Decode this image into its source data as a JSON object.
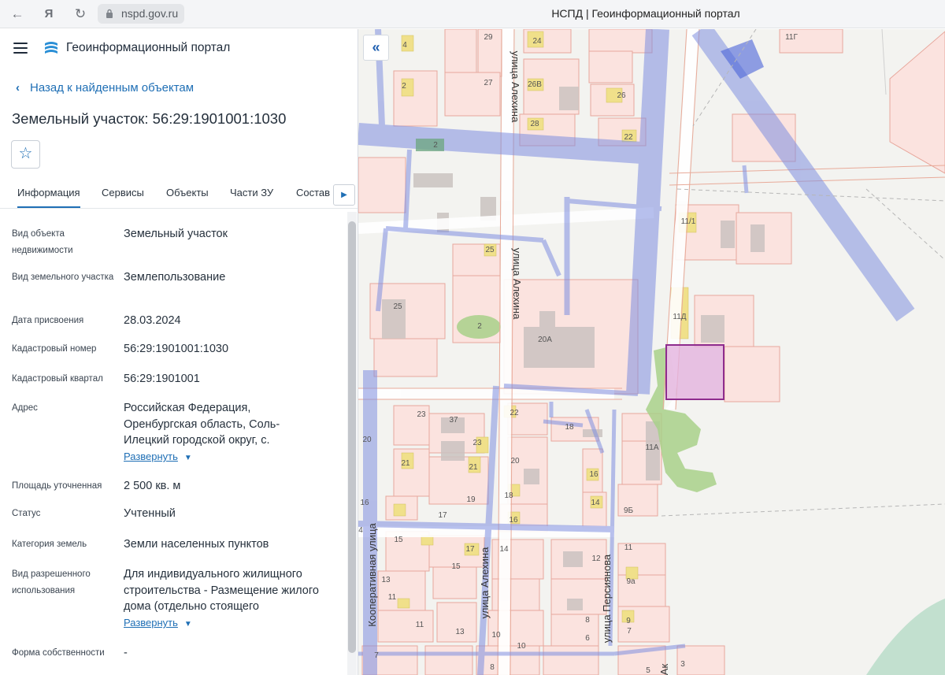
{
  "browser": {
    "url": "nspd.gov.ru",
    "tab_title": "НСПД | Геоинформационный портал"
  },
  "header": {
    "title": "Геоинформационный портал"
  },
  "back_link": "Назад к найденным объектам",
  "object_title": "Земельный участок: 56:29:1901001:1030",
  "tabs": [
    {
      "label": "Информация",
      "active": true
    },
    {
      "label": "Сервисы"
    },
    {
      "label": "Объекты"
    },
    {
      "label": "Части ЗУ"
    },
    {
      "label": "Состав"
    }
  ],
  "details": {
    "object_type": {
      "label": "Вид объекта недвижимости",
      "value": "Земельный участок"
    },
    "land_type": {
      "label": "Вид земельного участка",
      "value": "Землепользование"
    },
    "assign_date": {
      "label": "Дата присвоения",
      "value": "28.03.2024"
    },
    "cad_number": {
      "label": "Кадастровый номер",
      "value": "56:29:1901001:1030"
    },
    "cad_quarter": {
      "label": "Кадастровый квартал",
      "value": "56:29:1901001"
    },
    "address": {
      "label": "Адрес",
      "value": "Российская Федерация, Оренбургская область, Соль-Илецкий городской округ, с."
    },
    "area": {
      "label": "Площадь уточненная",
      "value": "2 500 кв. м"
    },
    "status": {
      "label": "Статус",
      "value": "Учтенный"
    },
    "land_category": {
      "label": "Категория земель",
      "value": "Земли населенных пунктов"
    },
    "permitted_use": {
      "label": "Вид разрешенного использования",
      "value": "Для индивидуального жилищного строительства - Размещение жилого дома (отдельно стоящего"
    },
    "ownership": {
      "label": "Форма собственности",
      "value": "-"
    }
  },
  "expand_label": "Развернуть",
  "map": {
    "street_labels": [
      "улица Алехина",
      "улица Алехина",
      "Кооперативная улица",
      "улица Алехина",
      "улица Персиянова",
      "Ак"
    ],
    "parcel_labels": [
      "29",
      "24",
      "4",
      "27",
      "26В",
      "26",
      "11Г",
      "2",
      "28",
      "22",
      "2",
      "11/1",
      "25",
      "25",
      "2",
      "20А",
      "11Д",
      "23",
      "37",
      "22",
      "18",
      "20",
      "23",
      "11А",
      "21",
      "21",
      "20",
      "16",
      "19",
      "18",
      "16",
      "14",
      "17",
      "9Б",
      "16",
      "15",
      "17",
      "14",
      "12",
      "11",
      "4",
      "15",
      "13",
      "9а",
      "11",
      "11",
      "9",
      "8",
      "13",
      "10",
      "7",
      "6",
      "10",
      "7",
      "8",
      "5",
      "3"
    ]
  },
  "colors": {
    "accent": "#1f6fb5",
    "selected_parcel": "#8e2c8e",
    "map_background": "#f3f3f0",
    "building_fill": "#f7d9d5"
  }
}
